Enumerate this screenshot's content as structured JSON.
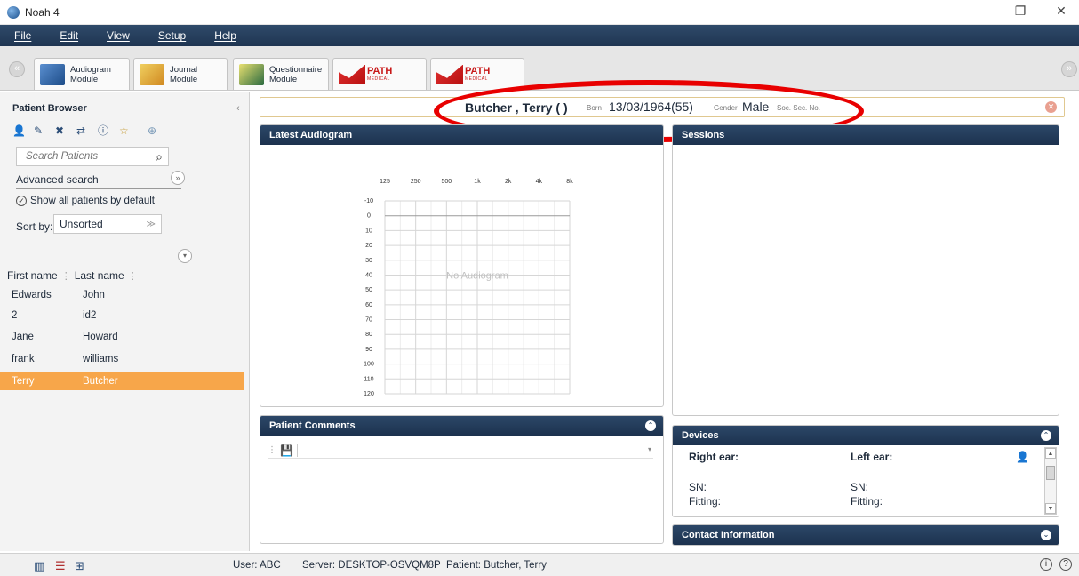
{
  "window": {
    "title": "Noah 4",
    "minimize_glyph": "—",
    "restore_glyph": "❐",
    "close_glyph": "✕"
  },
  "menu": [
    "File",
    "Edit",
    "View",
    "Setup",
    "Help"
  ],
  "modules": [
    {
      "line1": "Audiogram",
      "line2": "Module",
      "icon": "audiogram-icon"
    },
    {
      "line1": "Journal",
      "line2": "Module",
      "icon": "journal-icon"
    },
    {
      "line1": "Questionnaire",
      "line2": "Module",
      "icon": "questionnaire-icon"
    },
    {
      "logo": "PATH",
      "sub": "MEDICAL"
    },
    {
      "logo": "PATH",
      "sub": "MEDICAL"
    }
  ],
  "patient_browser": {
    "title": "Patient Browser",
    "search_placeholder": "Search Patients",
    "advanced_search": "Advanced search",
    "show_all": "Show all patients by default",
    "sort_label": "Sort by:",
    "sort_value": "Unsorted",
    "columns": [
      "First name",
      "Last name"
    ],
    "patients": [
      {
        "first": "Edwards",
        "last": "John"
      },
      {
        "first": "2",
        "last": "id2"
      },
      {
        "first": "Jane",
        "last": "Howard"
      },
      {
        "first": "frank",
        "last": "williams"
      },
      {
        "first": "Terry",
        "last": "Butcher"
      }
    ],
    "selected_index": 4
  },
  "patient_header": {
    "name": "Butcher , Terry ( )",
    "born_label": "Born",
    "born": "13/03/1964(55)",
    "gender_label": "Gender",
    "gender": "Male",
    "ssn_label": "Soc. Sec. No."
  },
  "latest_audiogram": {
    "title": "Latest Audiogram",
    "empty_text": "No Audiogram",
    "freq_labels": [
      "125",
      "250",
      "500",
      "1k",
      "2k",
      "4k",
      "8k"
    ],
    "db_labels": [
      "-10",
      "0",
      "10",
      "20",
      "30",
      "40",
      "50",
      "60",
      "70",
      "80",
      "90",
      "100",
      "110",
      "120"
    ]
  },
  "sessions": {
    "title": "Sessions"
  },
  "patient_comments": {
    "title": "Patient Comments"
  },
  "devices": {
    "title": "Devices",
    "right_ear": "Right ear:",
    "left_ear": "Left ear:",
    "sn": "SN:",
    "fitting": "Fitting:"
  },
  "contact_information": {
    "title": "Contact Information"
  },
  "status": {
    "user": "User: ABC",
    "server": "Server: DESKTOP-OSVQM8P",
    "patient": "Patient: Butcher, Terry"
  },
  "colors": {
    "accent": "#f7a64a",
    "header": "#2c4768",
    "highlight": "#e80000"
  }
}
